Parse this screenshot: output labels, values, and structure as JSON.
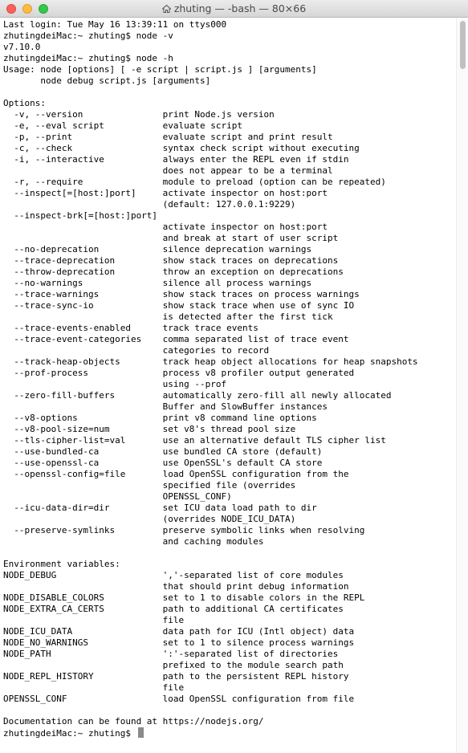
{
  "window": {
    "title": "zhuting — -bash — 80×66"
  },
  "terminal": {
    "lines": [
      "Last login: Tue May 16 13:39:11 on ttys000",
      "zhutingdeiMac:~ zhuting$ node -v",
      "v7.10.0",
      "zhutingdeiMac:~ zhuting$ node -h",
      "Usage: node [options] [ -e script | script.js ] [arguments]",
      "       node debug script.js [arguments]",
      "",
      "Options:",
      "  -v, --version               print Node.js version",
      "  -e, --eval script           evaluate script",
      "  -p, --print                 evaluate script and print result",
      "  -c, --check                 syntax check script without executing",
      "  -i, --interactive           always enter the REPL even if stdin",
      "                              does not appear to be a terminal",
      "  -r, --require               module to preload (option can be repeated)",
      "  --inspect[=[host:]port]     activate inspector on host:port",
      "                              (default: 127.0.0.1:9229)",
      "  --inspect-brk[=[host:]port]",
      "                              activate inspector on host:port",
      "                              and break at start of user script",
      "  --no-deprecation            silence deprecation warnings",
      "  --trace-deprecation         show stack traces on deprecations",
      "  --throw-deprecation         throw an exception on deprecations",
      "  --no-warnings               silence all process warnings",
      "  --trace-warnings            show stack traces on process warnings",
      "  --trace-sync-io             show stack trace when use of sync IO",
      "                              is detected after the first tick",
      "  --trace-events-enabled      track trace events",
      "  --trace-event-categories    comma separated list of trace event",
      "                              categories to record",
      "  --track-heap-objects        track heap object allocations for heap snapshots",
      "  --prof-process              process v8 profiler output generated",
      "                              using --prof",
      "  --zero-fill-buffers         automatically zero-fill all newly allocated",
      "                              Buffer and SlowBuffer instances",
      "  --v8-options                print v8 command line options",
      "  --v8-pool-size=num          set v8's thread pool size",
      "  --tls-cipher-list=val       use an alternative default TLS cipher list",
      "  --use-bundled-ca            use bundled CA store (default)",
      "  --use-openssl-ca            use OpenSSL's default CA store",
      "  --openssl-config=file       load OpenSSL configuration from the",
      "                              specified file (overrides",
      "                              OPENSSL_CONF)",
      "  --icu-data-dir=dir          set ICU data load path to dir",
      "                              (overrides NODE_ICU_DATA)",
      "  --preserve-symlinks         preserve symbolic links when resolving",
      "                              and caching modules",
      "",
      "Environment variables:",
      "NODE_DEBUG                    ','-separated list of core modules",
      "                              that should print debug information",
      "NODE_DISABLE_COLORS           set to 1 to disable colors in the REPL",
      "NODE_EXTRA_CA_CERTS           path to additional CA certificates",
      "                              file",
      "NODE_ICU_DATA                 data path for ICU (Intl object) data",
      "NODE_NO_WARNINGS              set to 1 to silence process warnings",
      "NODE_PATH                     ':'-separated list of directories",
      "                              prefixed to the module search path",
      "NODE_REPL_HISTORY             path to the persistent REPL history",
      "                              file",
      "OPENSSL_CONF                  load OpenSSL configuration from file",
      "",
      "Documentation can be found at https://nodejs.org/"
    ],
    "prompt": "zhutingdeiMac:~ zhuting$ "
  },
  "colors": {
    "background": "#ffffff",
    "text": "#000000",
    "cursor": "#8a8a8a"
  }
}
